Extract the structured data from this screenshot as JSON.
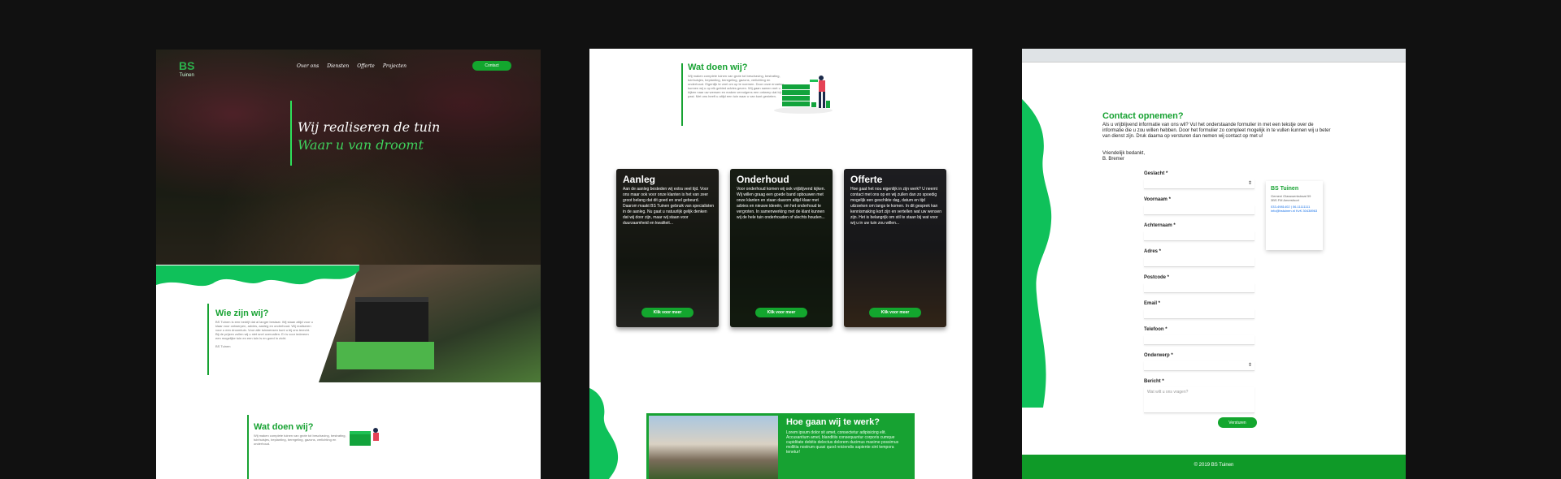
{
  "colors": {
    "accent": "#17a232",
    "background": "#111111",
    "hero_highlight": "#3fd25c"
  },
  "home": {
    "logo": {
      "mark": "BS",
      "sub": "Tuinen"
    },
    "nav": [
      "Over ons",
      "Diensten",
      "Offerte",
      "Projecten"
    ],
    "contact_button": "Contact",
    "hero_line1": "Wij realiseren de tuin",
    "hero_line2": "Waar u van droomt",
    "who_title": "Wie zijn wij?",
    "who_text": "BS Tuinen is een bedrijf dat al langer bestaat. Wij staan altijd voor u klaar voor ontwerpen, advies, aanleg en onderhoud. Wij realiseren voor u een droomtuin. Voor alle tuinwensen kunt u bij ons terecht. Bij de prijzen zullen wij u niet snel overvallen. Er is voor iedereen een mogelijke tuin en een tuin is en goed in zicht.",
    "who_sign": "BS Tuinen",
    "what_title": "Wat doen wij?",
    "what_text": "Wij maken complete tuinen van grote tot beschaving, bestrating, tuinhuisjes, beplanting, beregeling, gazons, verlichting en onderhoud."
  },
  "services": {
    "what_title": "Wat doen wij?",
    "what_text": "Wij maken complete tuinen van grote tot beschaving, bestrating, tuinhuisjes, beplanting, beregeling, gazons, verlichting en onderhoud. Eigenlijk te veel om op te noemen. Door onze ervaring kunnen wij u op elk gebied advies geven. Wij gaan samen met u kijken naar uw wensen en maken vervolgens een ontwerp dat bij u past. Met ons heeft u altijd een tuin waar u van kunt genieten.",
    "cards": [
      {
        "title": "Aanleg",
        "text": "Aan de aanleg besteden wij extra veel tijd. Voor ons maar ook voor onze klanten is het van zeer groot belang dat dit goed en snel gebeurd. Daarom maakt BS Tuinen gebruik van specialisten in de aanleg. Nu gaat u natuurlijk gelijk denken dat wij door zijn, maar wij staan voor duurzaamheid en kwaliteit...",
        "button": "Klik voor meer"
      },
      {
        "title": "Onderhoud",
        "text": "Voor onderhoud komen wij ook vrijblijvend kijken. Wij willen graag een goede band opbouwen met onze klanten en staan daarom altijd klaar met advies en nieuwe ideeën, om het onderhoud te vergroten. In samenwerking met de klant kunnen wij de hele tuin onderhouden of slechts houden...",
        "button": "Klik voor meer"
      },
      {
        "title": "Offerte",
        "text": "Hoe gaat het nou eigenlijk in zijn werk? U neemt contact met ons op en wij zullen dan zo spoedig mogelijk een geschikte dag, datum en tijd uitzoeken om langs te komen. In dit gesprek kan kennismaking kort zijn en vertellen wat uw wensen zijn. Het is belangrijk om stil te staan bij wat voor wij u in uw tuin zou willen...",
        "button": "Klik voor meer"
      }
    ],
    "work_title": "Hoe gaan wij te werk?",
    "work_text": "Lorem ipsum dolor sit amet, consectetur adipisicing elit. Accusantium amet, blanditiis consequuntur corporis cumque cupiditate debitis delectus dolorem ducimus maxime possimus mollitia nostrum quasi quod reiciendis sapiente sint tempora tenetur!"
  },
  "contact": {
    "title": "Contact opnemen?",
    "intro": "Als u vrijblijvend informatie van ons wil? Vul het onderstaande formulier in met een tekstje over de informatie die u zou willen hebben. Door het formulier zo compleet mogelijk in te vullen kunnen wij u beter van dienst zijn. Druk daarna op versturen dan nemen wij contact op met u!",
    "regards": "Vriendelijk bedankt,",
    "signature": "B. Bremer",
    "fields": [
      "Geslacht *",
      "Voornaam *",
      "Achternaam *",
      "Adres *",
      "Postcode *",
      "Email *",
      "Telefoon *",
      "Onderwerp *",
      "Bericht *"
    ],
    "message_placeholder": "Wat wilt u ons vragen?",
    "send_button": "Versturen",
    "card_title": "BS Tuinen",
    "card_address": "Gemeni Glasswerkstraat 59 3BS FM Amersfoort",
    "card_links": "033-4981402 | 06-11111111 info@bstuinen.nl KvK 30438963",
    "footer": "© 2019 BS Tuinen"
  }
}
